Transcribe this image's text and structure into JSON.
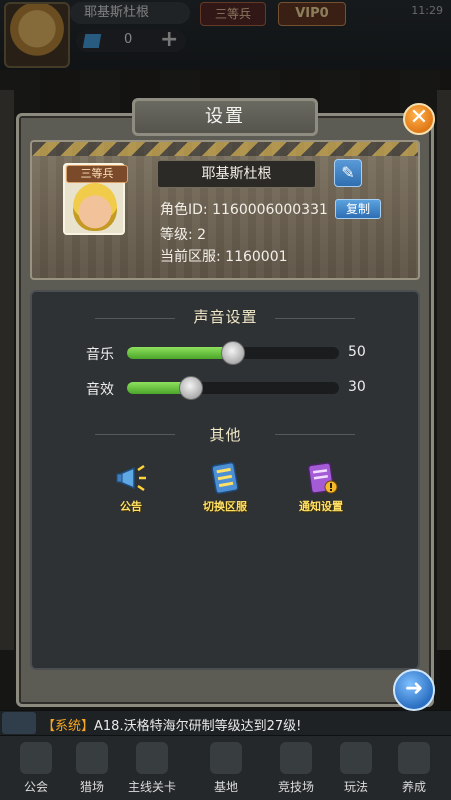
{
  "top_bar": {
    "player_name": "耶基斯杜根",
    "rank": "三等兵",
    "vip": "VIP0",
    "time": "11:29",
    "gem_count": "0",
    "add_label": "+"
  },
  "modal": {
    "title": "设置",
    "close_label": "✕",
    "profile": {
      "rank_badge": "三等兵",
      "name": "耶基斯杜根",
      "edit_label": "✎",
      "role_id_label": "角色ID:",
      "role_id": "1160006000331",
      "copy_label": "复制",
      "level_label": "等级:",
      "level": "2",
      "server_label": "当前区服:",
      "server": "1160001"
    },
    "sound": {
      "title": "声音设置",
      "music_label": "音乐",
      "music_value": 50,
      "sfx_label": "音效",
      "sfx_value": 30
    },
    "other": {
      "title": "其他",
      "actions": [
        {
          "label": "公告",
          "icon": "megaphone-icon"
        },
        {
          "label": "切换区服",
          "icon": "server-switch-icon"
        },
        {
          "label": "通知设置",
          "icon": "notification-icon"
        }
      ]
    }
  },
  "ticker": {
    "tag": "【系统】",
    "text": "A18.沃格特海尔研制等级达到27级!"
  },
  "nav": [
    {
      "label": "公会"
    },
    {
      "label": "猎场"
    },
    {
      "label": "主线关卡"
    },
    {
      "label": "基地"
    },
    {
      "label": "竞技场"
    },
    {
      "label": "玩法"
    },
    {
      "label": "养成"
    }
  ],
  "colors": {
    "slider_fill": "#6cc93f",
    "accent_orange": "#e07917",
    "accent_blue": "#2f6fb0",
    "title_text": "#f1e8c8",
    "action_label": "#ffe066"
  }
}
